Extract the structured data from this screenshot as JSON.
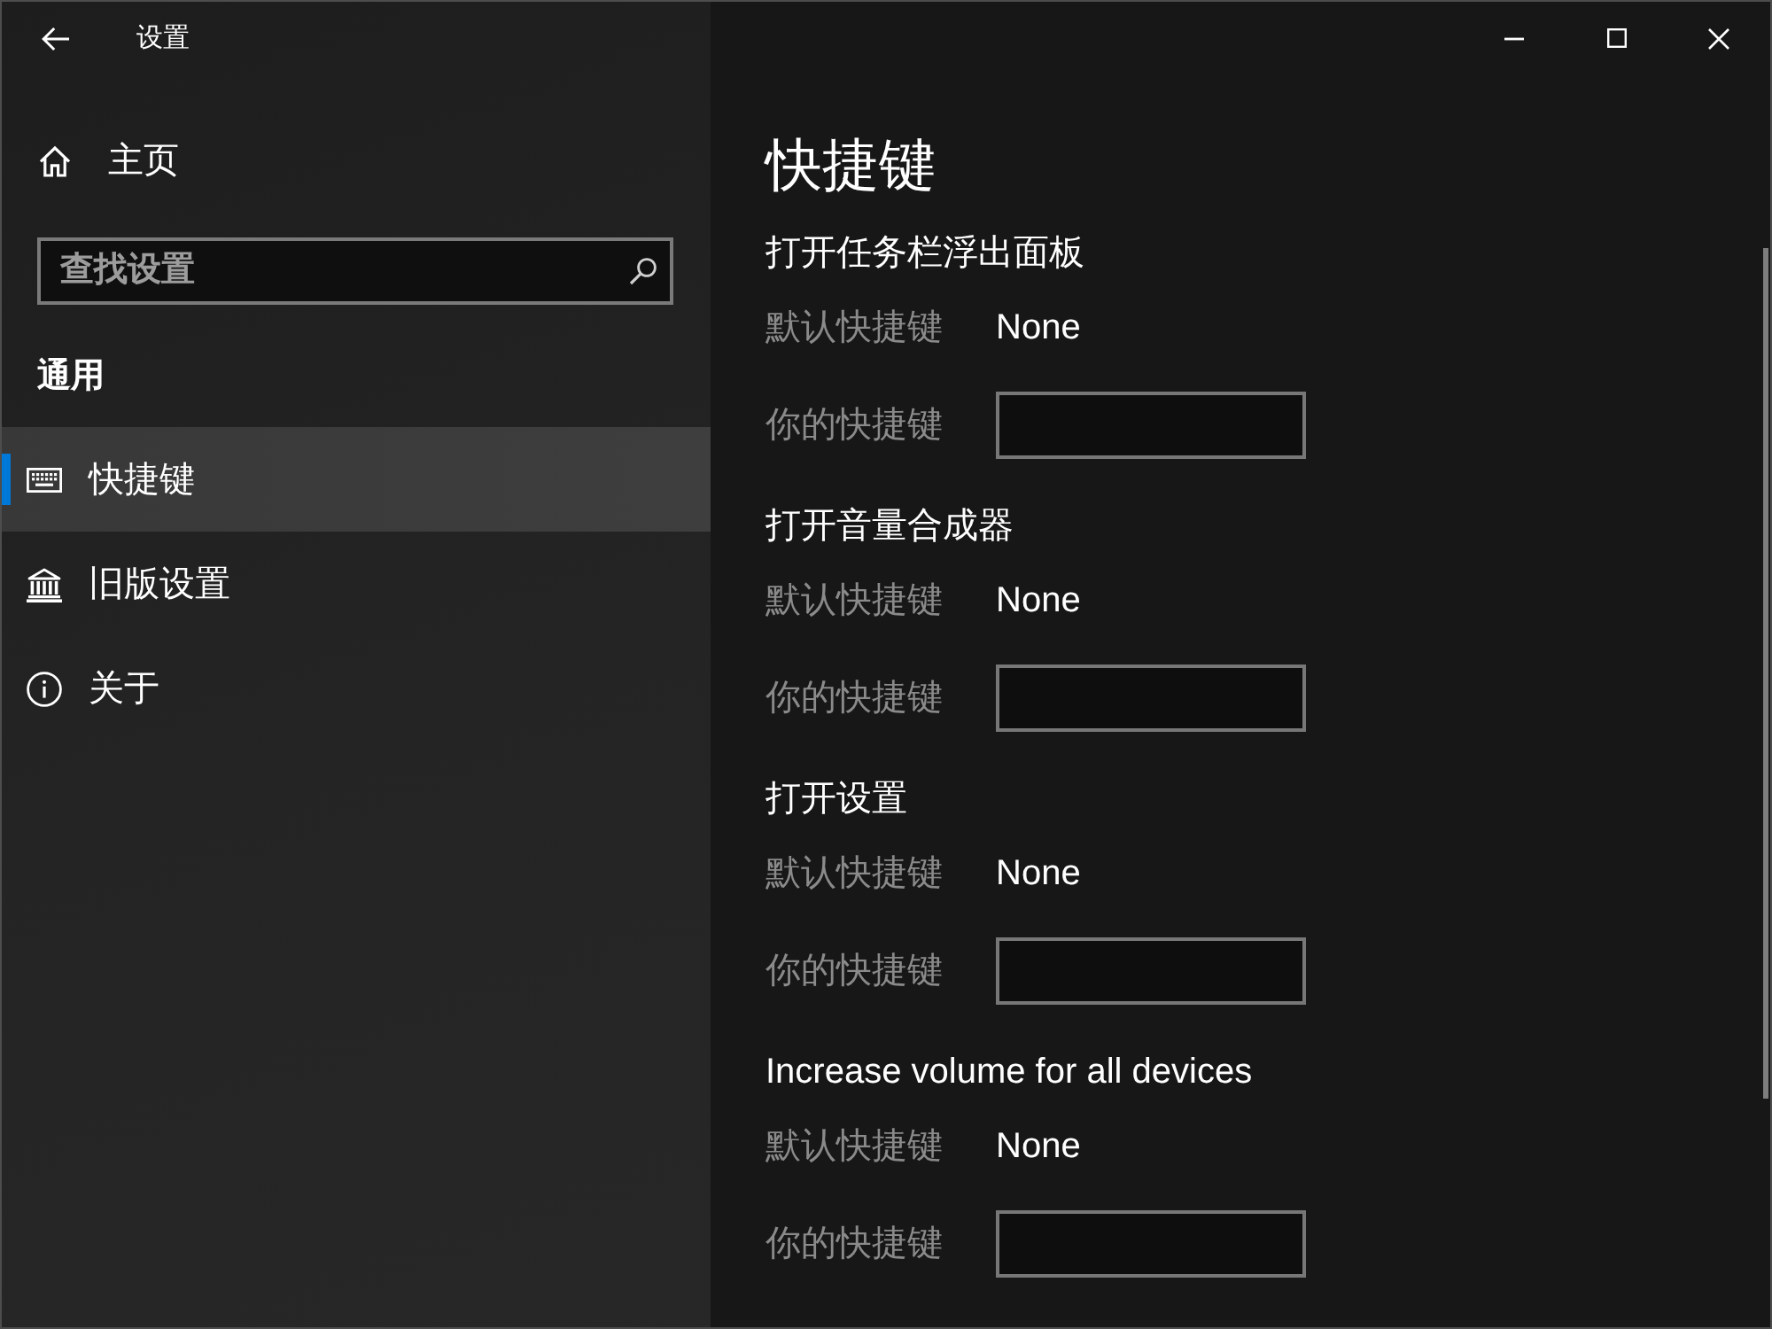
{
  "window": {
    "title": "设置"
  },
  "sidebar": {
    "home": {
      "label": "主页"
    },
    "search": {
      "placeholder": "查找设置"
    },
    "section_title": "通用",
    "items": [
      {
        "label": "快捷键",
        "selected": true
      },
      {
        "label": "旧版设置",
        "selected": false
      },
      {
        "label": "关于",
        "selected": false
      }
    ]
  },
  "content": {
    "title": "快捷键",
    "groups": [
      {
        "heading": "打开任务栏浮出面板",
        "default_label": "默认快捷键",
        "default_value": "None",
        "custom_label": "你的快捷键"
      },
      {
        "heading": "打开音量合成器",
        "default_label": "默认快捷键",
        "default_value": "None",
        "custom_label": "你的快捷键"
      },
      {
        "heading": "打开设置",
        "default_label": "默认快捷键",
        "default_value": "None",
        "custom_label": "你的快捷键"
      },
      {
        "heading": "Increase volume for all devices",
        "default_label": "默认快捷键",
        "default_value": "None",
        "custom_label": "你的快捷键"
      }
    ]
  }
}
